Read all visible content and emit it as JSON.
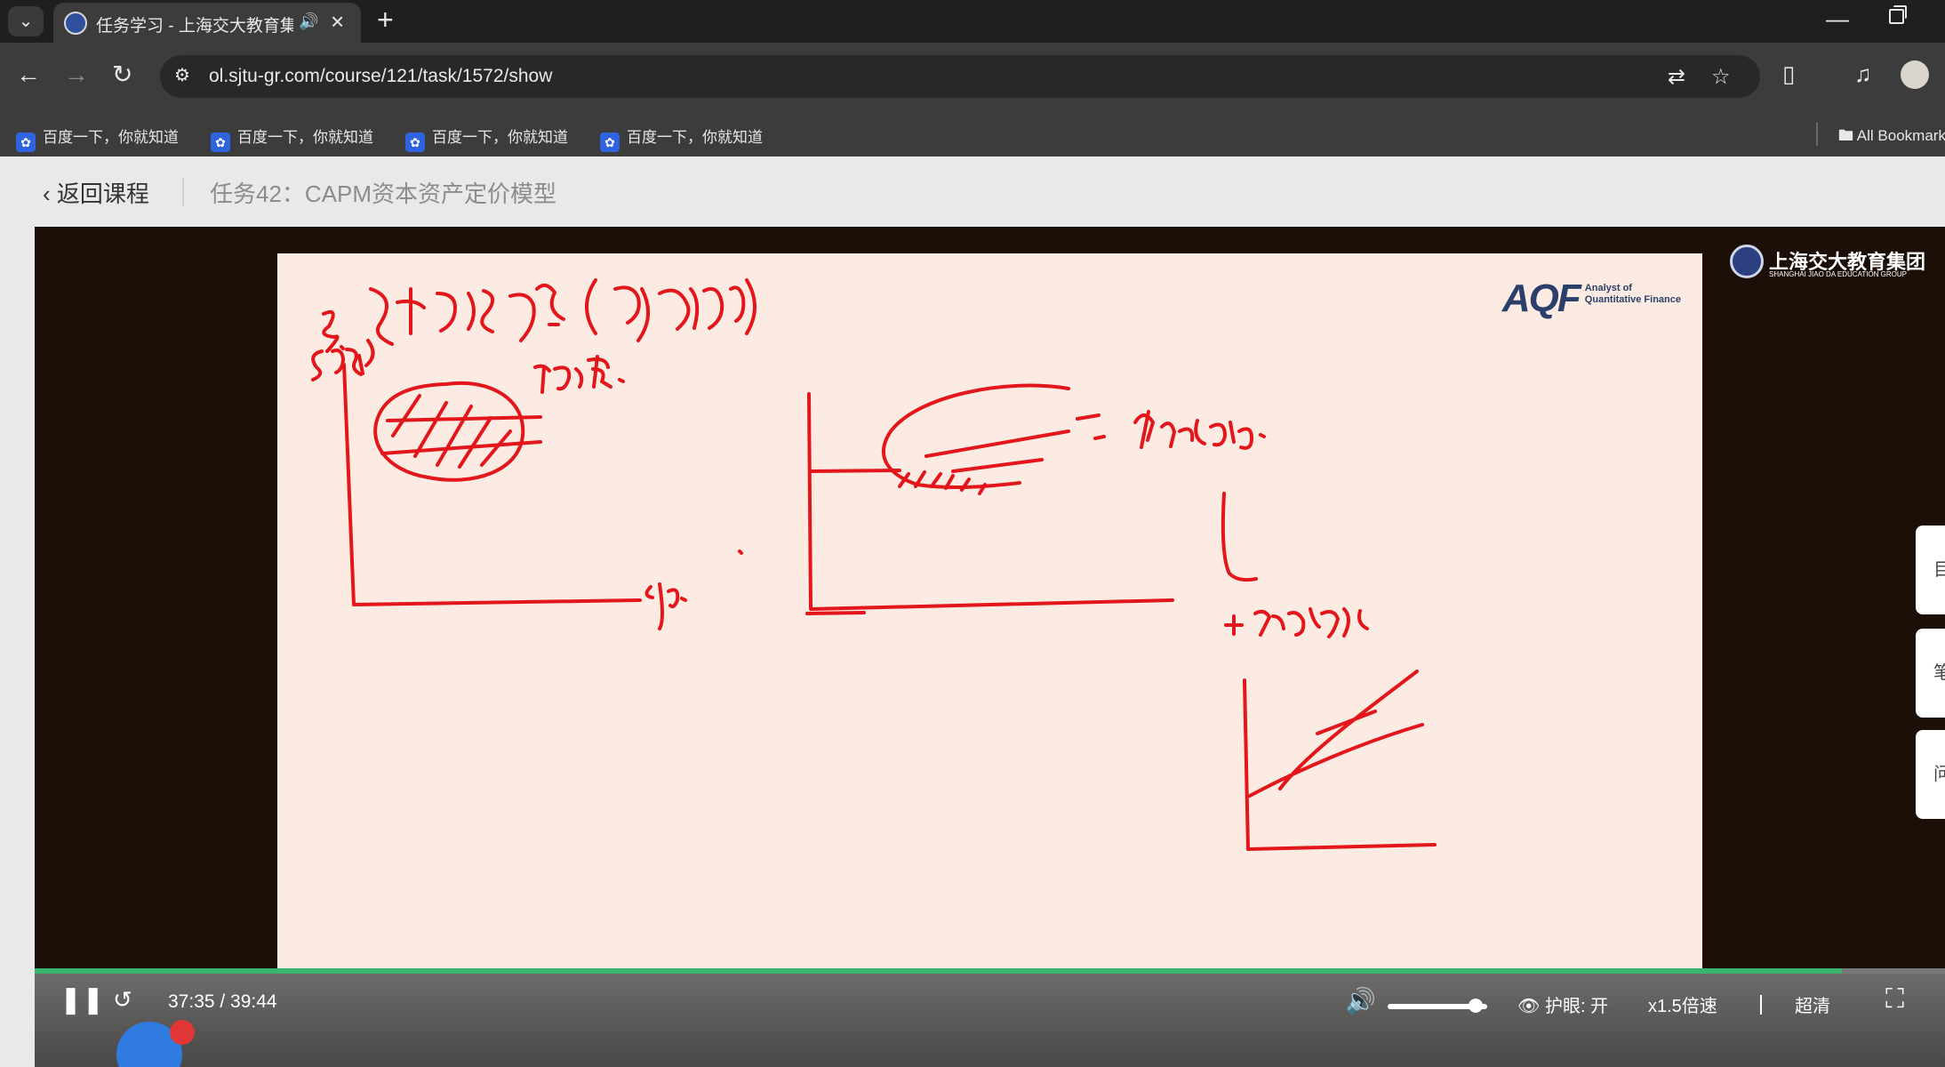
{
  "browser": {
    "tab_title": "任务学习 - 上海交大教育集团",
    "new_tab": "+",
    "url": "ol.sjtu-gr.com/course/121/task/1572/show",
    "bookmarks": [
      "百度一下，你就知道",
      "百度一下，你就知道",
      "百度一下，你就知道",
      "百度一下，你就知道"
    ],
    "all_bookmarks": "All Bookmarks"
  },
  "page": {
    "back_label": "返回课程",
    "task_title": "任务42：CAPM资本资产定价模型"
  },
  "video": {
    "slide_logo": "AQF",
    "slide_logo_subtitle": [
      "Analyst of",
      "Quantitative Finance"
    ],
    "school_logo_cn": "上海交大教育集团",
    "school_logo_en": "SHANGHAI JIAO DA EDUCATION GROUP",
    "side_tabs": [
      "目",
      "笔",
      "问"
    ],
    "current_time": "37:35",
    "duration": "39:44",
    "time_display": "37:35 / 39:44",
    "progress": 0.946,
    "volume": 0.88,
    "eye_protection": "护眼: 开",
    "speed": "x1.5倍速",
    "quality": "超清",
    "colors": {
      "progress": "#3bb56c",
      "ink": "#e3161b"
    }
  }
}
